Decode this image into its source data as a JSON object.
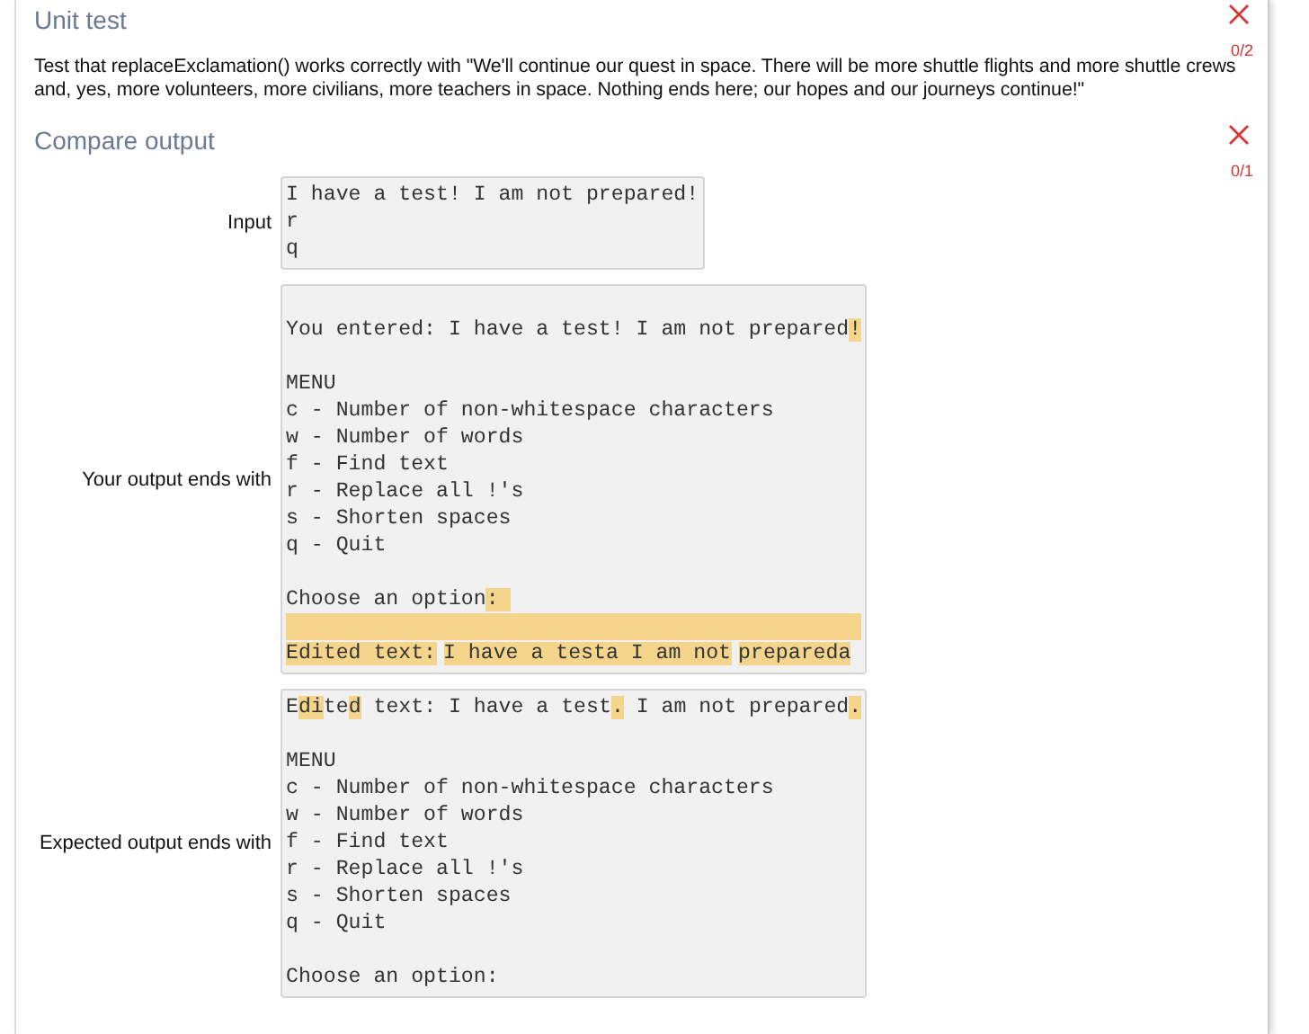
{
  "sections": [
    {
      "title": "Unit test",
      "passed": false,
      "score": "0/2",
      "description": "Test that replaceExclamation() works correctly with \"We'll continue our quest in space. There will be more shuttle flights and more shuttle crews and, yes, more volunteers, more civilians, more teachers in space. Nothing ends here; our hopes and our journeys continue!\""
    },
    {
      "title": "Compare output",
      "passed": false,
      "score": "0/1",
      "rows": [
        {
          "label": "Input",
          "lines": [
            {
              "kind": "text",
              "segments": [
                {
                  "text": "I have a test! I am not prepared!",
                  "highlighted": false
                }
              ]
            },
            {
              "kind": "text",
              "segments": [
                {
                  "text": "r",
                  "highlighted": false
                }
              ]
            },
            {
              "kind": "text",
              "segments": [
                {
                  "text": "q",
                  "highlighted": false
                }
              ]
            }
          ]
        },
        {
          "label": "Your output ends with",
          "lines": [
            {
              "kind": "blank"
            },
            {
              "kind": "text",
              "segments": [
                {
                  "text": "You entered: I have a test! I am not prepared",
                  "highlighted": false
                },
                {
                  "text": "!",
                  "highlighted": true
                }
              ]
            },
            {
              "kind": "blank"
            },
            {
              "kind": "text",
              "segments": [
                {
                  "text": "MENU",
                  "highlighted": false
                }
              ]
            },
            {
              "kind": "text",
              "segments": [
                {
                  "text": "c - Number of non-whitespace characters",
                  "highlighted": false
                }
              ]
            },
            {
              "kind": "text",
              "segments": [
                {
                  "text": "w - Number of words",
                  "highlighted": false
                }
              ]
            },
            {
              "kind": "text",
              "segments": [
                {
                  "text": "f - Find text",
                  "highlighted": false
                }
              ]
            },
            {
              "kind": "text",
              "segments": [
                {
                  "text": "r - Replace all !'s",
                  "highlighted": false
                }
              ]
            },
            {
              "kind": "text",
              "segments": [
                {
                  "text": "s - Shorten spaces",
                  "highlighted": false
                }
              ]
            },
            {
              "kind": "text",
              "segments": [
                {
                  "text": "q - Quit",
                  "highlighted": false
                }
              ]
            },
            {
              "kind": "blank"
            },
            {
              "kind": "text",
              "segments": [
                {
                  "text": "Choose an option",
                  "highlighted": false
                },
                {
                  "text": ": ",
                  "highlighted": true
                }
              ]
            },
            {
              "kind": "blank",
              "highlighted": true
            },
            {
              "kind": "text",
              "segments": [
                {
                  "text": "Edited text:",
                  "highlighted": true
                },
                {
                  "text": "I have a testa I am not",
                  "highlighted": true
                },
                {
                  "text": "prepareda",
                  "highlighted": true
                }
              ]
            }
          ]
        },
        {
          "label": "Expected output ends with",
          "lines": [
            {
              "kind": "text",
              "segments": [
                {
                  "text": "E",
                  "highlighted": false
                },
                {
                  "text": "di",
                  "highlighted": true
                },
                {
                  "text": "te",
                  "highlighted": false
                },
                {
                  "text": "d",
                  "highlighted": true
                },
                {
                  "text": " text: I have a test",
                  "highlighted": false
                },
                {
                  "text": ".",
                  "highlighted": true
                },
                {
                  "text": " I am not prepared",
                  "highlighted": false
                },
                {
                  "text": ".",
                  "highlighted": true
                }
              ]
            },
            {
              "kind": "blank"
            },
            {
              "kind": "text",
              "segments": [
                {
                  "text": "MENU",
                  "highlighted": false
                }
              ]
            },
            {
              "kind": "text",
              "segments": [
                {
                  "text": "c - Number of non-whitespace characters",
                  "highlighted": false
                }
              ]
            },
            {
              "kind": "text",
              "segments": [
                {
                  "text": "w - Number of words",
                  "highlighted": false
                }
              ]
            },
            {
              "kind": "text",
              "segments": [
                {
                  "text": "f - Find text",
                  "highlighted": false
                }
              ]
            },
            {
              "kind": "text",
              "segments": [
                {
                  "text": "r - Replace all !'s",
                  "highlighted": false
                }
              ]
            },
            {
              "kind": "text",
              "segments": [
                {
                  "text": "s - Shorten spaces",
                  "highlighted": false
                }
              ]
            },
            {
              "kind": "text",
              "segments": [
                {
                  "text": "q - Quit",
                  "highlighted": false
                }
              ]
            },
            {
              "kind": "blank"
            },
            {
              "kind": "text",
              "segments": [
                {
                  "text": "Choose an option:",
                  "highlighted": false
                }
              ]
            }
          ]
        }
      ]
    }
  ]
}
